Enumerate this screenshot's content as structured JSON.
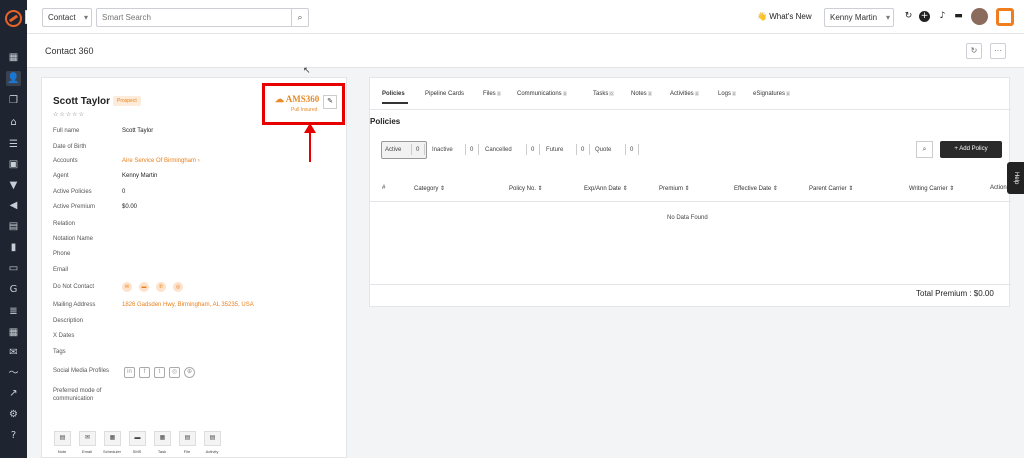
{
  "topbar": {
    "module_select": "Contact",
    "search_placeholder": "Smart Search",
    "whats_new": "What's New",
    "agent_select": "Kenny Martin"
  },
  "header": {
    "title": "Contact 360"
  },
  "contact": {
    "name": "Scott Taylor",
    "badge": "Prospect",
    "stars": "☆☆☆☆☆",
    "ams_logo": "AMS360",
    "ams_sub": "Pull Insured",
    "fields": [
      {
        "label": "Full name",
        "value": "Scott Taylor",
        "link": false
      },
      {
        "label": "Date of Birth",
        "value": "",
        "link": false
      },
      {
        "label": "Accounts",
        "value": "Aire Service Of Birmingham ›",
        "link": true
      },
      {
        "label": "Agent",
        "value": "Kenny Martin",
        "link": false
      },
      {
        "label": "Active Policies",
        "value": "0",
        "link": false
      },
      {
        "label": "Active Premium",
        "value": "$0.00",
        "link": false
      },
      {
        "label": "Relation",
        "value": "",
        "link": false
      },
      {
        "label": "Notation Name",
        "value": "",
        "link": false
      },
      {
        "label": "Phone",
        "value": "",
        "link": false
      },
      {
        "label": "Email",
        "value": "",
        "link": false
      },
      {
        "label": "Do Not Contact",
        "value": "",
        "link": false
      },
      {
        "label": "Mailing Address",
        "value": "1826 Gadsden Hwy, Birmingham, AL 35235, USA",
        "link": true
      },
      {
        "label": "Description",
        "value": "",
        "link": false
      },
      {
        "label": "X Dates",
        "value": "",
        "link": false
      },
      {
        "label": "Tags",
        "value": "",
        "link": false
      },
      {
        "label": "Social Media Profiles",
        "value": "",
        "link": false
      }
    ],
    "comm_pref_label_1": "Preferred mode of",
    "comm_pref_label_2": "communication",
    "actions": [
      "Note",
      "Email",
      "Scheduler",
      "SMS",
      "Task",
      "File",
      "Activity"
    ]
  },
  "tabs": [
    {
      "label": "Policies",
      "count": ""
    },
    {
      "label": "Pipeline Cards",
      "count": ""
    },
    {
      "label": "Files",
      "count": "0"
    },
    {
      "label": "Communications",
      "count": "0"
    },
    {
      "label": "Tasks",
      "count": "0"
    },
    {
      "label": "Notes",
      "count": "0"
    },
    {
      "label": "Activities",
      "count": "0"
    },
    {
      "label": "Logs",
      "count": "0"
    },
    {
      "label": "eSignatures",
      "count": "0"
    }
  ],
  "policies": {
    "title": "Policies",
    "filters": [
      {
        "label": "Active",
        "count": "0"
      },
      {
        "label": "Inactive",
        "count": "0"
      },
      {
        "label": "Cancelled",
        "count": "0"
      },
      {
        "label": "Future",
        "count": "0"
      },
      {
        "label": "Quote",
        "count": "0"
      }
    ],
    "add_button": "+ Add Policy",
    "columns": [
      "#",
      "Category ⇕",
      "Policy No. ⇕",
      "Exp/Ann Date ⇕",
      "Premium ⇕",
      "Effective Date ⇕",
      "Parent Carrier ⇕",
      "Writing Carrier ⇕",
      "Action"
    ],
    "no_data": "No Data Found",
    "total_label": "Total Premium : $0.00"
  },
  "help_label": "Help"
}
